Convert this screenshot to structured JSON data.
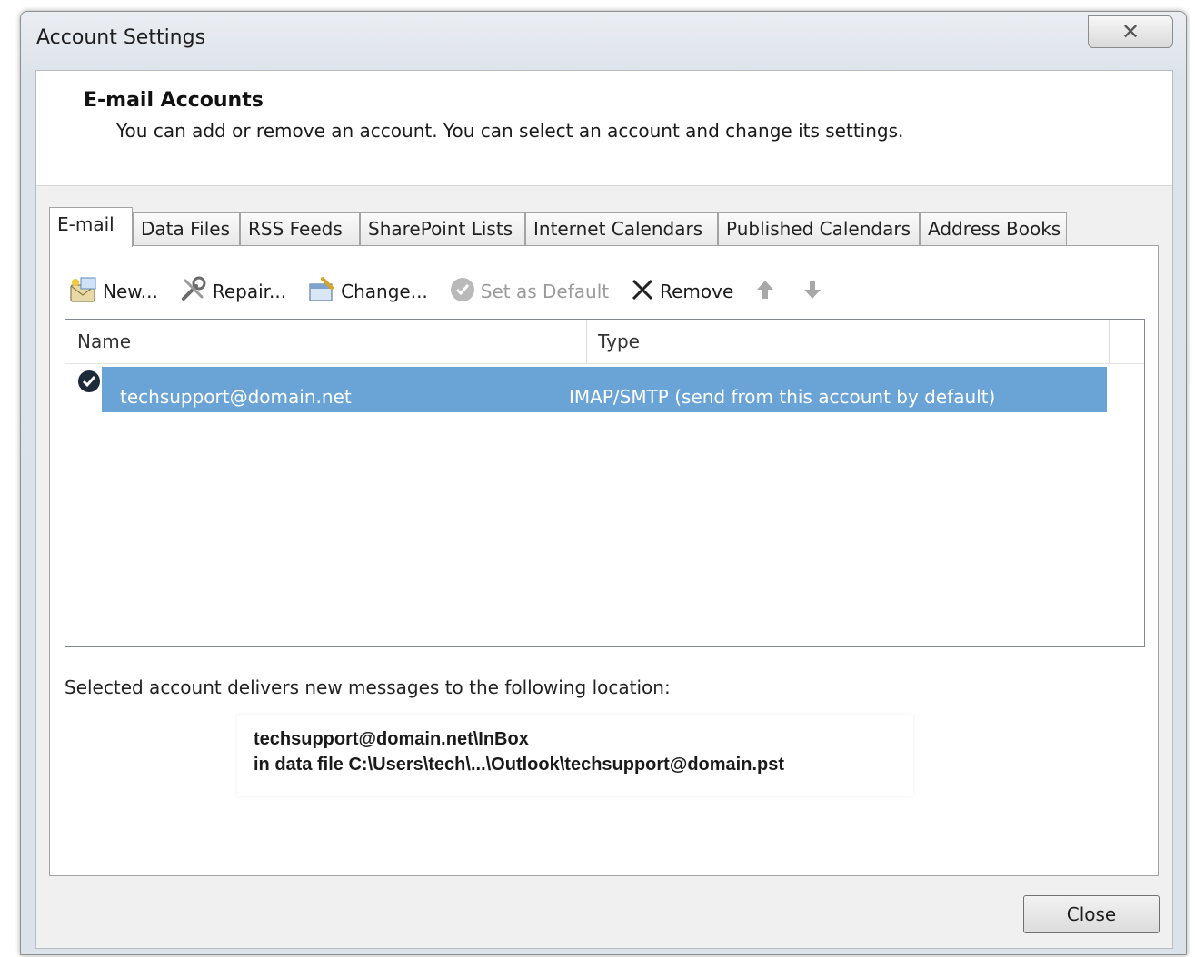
{
  "window": {
    "title": "Account Settings",
    "close_glyph": "✕"
  },
  "header": {
    "title": "E-mail Accounts",
    "description": "You can add or remove an account. You can select an account and change its settings."
  },
  "tabs": [
    {
      "label": "E-mail",
      "active": true
    },
    {
      "label": "Data Files",
      "active": false
    },
    {
      "label": "RSS Feeds",
      "active": false
    },
    {
      "label": "SharePoint Lists",
      "active": false
    },
    {
      "label": "Internet Calendars",
      "active": false
    },
    {
      "label": "Published Calendars",
      "active": false
    },
    {
      "label": "Address Books",
      "active": false
    }
  ],
  "toolbar": {
    "new_label": "New...",
    "repair_label": "Repair...",
    "change_label": "Change...",
    "set_default_label": "Set as Default",
    "remove_label": "Remove"
  },
  "accounts_list": {
    "columns": [
      "Name",
      "Type"
    ],
    "rows": [
      {
        "name": "techsupport@domain.net",
        "type": "IMAP/SMTP (send from this account by default)",
        "selected": true,
        "default": true
      }
    ]
  },
  "delivery": {
    "label": "Selected account delivers new messages to the following location:",
    "folder": "techsupport@domain.net\\InBox",
    "data_file": "in data file C:\\Users\\tech\\...\\Outlook\\techsupport@domain.pst"
  },
  "footer": {
    "close_label": "Close"
  },
  "colors": {
    "selection": "#6aa4d7",
    "selection_text": "#ffffff"
  }
}
